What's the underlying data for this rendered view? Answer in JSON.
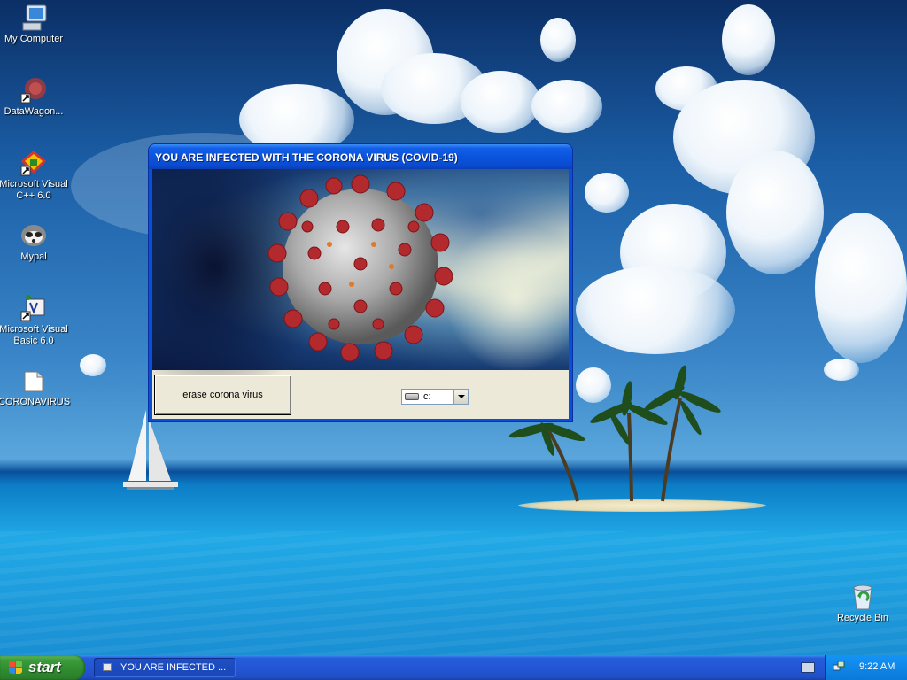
{
  "desktop": {
    "icons": [
      {
        "label": "My Computer",
        "icon": "my-computer-icon"
      },
      {
        "label": "DataWagon...",
        "icon": "datawagon-shortcut-icon"
      },
      {
        "label": "Microsoft Visual C++ 6.0",
        "icon": "visual-cpp-shortcut-icon"
      },
      {
        "label": "Mypal",
        "icon": "mypal-raccoon-icon"
      },
      {
        "label": "Microsoft Visual Basic 6.0",
        "icon": "visual-basic-shortcut-icon"
      },
      {
        "label": "CORONAVIRUS",
        "icon": "folder-icon"
      },
      {
        "label": "Recycle Bin",
        "icon": "recycle-bin-icon"
      }
    ]
  },
  "window": {
    "title": "YOU ARE INFECTED WITH THE CORONA VIRUS (COVID-19)",
    "image": "coronavirus-image",
    "erase_button": "erase corona virus",
    "drive_select": {
      "value": "c:",
      "icon": "hard-drive-icon"
    }
  },
  "taskbar": {
    "start_label": "start",
    "task_label": "YOU ARE INFECTED ...",
    "clock": "9:22 AM"
  },
  "colors": {
    "title_bar": "#0a54dd",
    "taskbar": "#245edb",
    "start_button": "#3c9b3c",
    "window_face": "#ece9d8"
  }
}
